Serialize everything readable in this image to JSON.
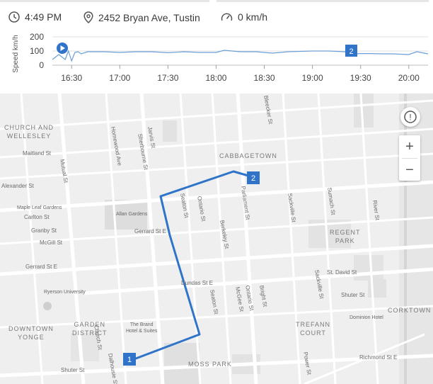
{
  "status": {
    "time": "4:49 PM",
    "address": "2452 Bryan Ave, Tustin",
    "speed": "0 km/h",
    "icons": [
      "clock-icon",
      "location-pin-icon",
      "speedometer-icon"
    ]
  },
  "chart_data": {
    "type": "line",
    "ylabel": "Speed km/h",
    "yticks": [
      "200",
      "100",
      "0"
    ],
    "ylim": [
      0,
      200
    ],
    "xticks": [
      "16:30",
      "17:00",
      "17:30",
      "18:00",
      "18:30",
      "19:00",
      "19:30",
      "20:00"
    ],
    "xlim": [
      "16:18",
      "20:12"
    ],
    "color": "#6a9fd8",
    "series": [
      {
        "x": [
          "16:18",
          "16:22",
          "16:26",
          "16:28",
          "16:30",
          "16:32",
          "16:34",
          "16:36",
          "16:40",
          "16:45",
          "16:50",
          "17:00",
          "17:10",
          "17:20",
          "17:30",
          "17:40",
          "17:50",
          "18:00",
          "18:05",
          "18:15",
          "18:25",
          "18:35",
          "18:45",
          "19:00",
          "19:10",
          "19:20",
          "19:25",
          "19:30",
          "19:35",
          "19:45",
          "19:50",
          "20:00",
          "20:05",
          "20:12"
        ],
        "y": [
          40,
          75,
          40,
          100,
          30,
          90,
          95,
          80,
          95,
          95,
          95,
          90,
          95,
          95,
          88,
          95,
          90,
          90,
          105,
          95,
          95,
          85,
          95,
          100,
          100,
          95,
          80,
          82,
          82,
          80,
          80,
          75,
          95,
          80
        ]
      }
    ],
    "markers": {
      "play": "play-icon",
      "waypoint_label": "2"
    }
  },
  "map": {
    "areas": [
      "CHURCH AND\nWELLESLEY",
      "CABBAGETOWN",
      "REGENT\nPARK",
      "CORKTOWN",
      "DOWNTOWN\nYONGE",
      "GARDEN\nDISTRICT",
      "TREFANN\nCOURT",
      "MOSS PARK"
    ],
    "streets": {
      "maitland": "Maitland St",
      "alexander": "Alexander St",
      "carlton": "Carlton St",
      "granby": "Granby St",
      "mcgill": "McGill St",
      "gerrard_w": "Gerrard St E",
      "gerrard_e": "Gerrard St E",
      "dundas": "Dundas St E",
      "shuter_e": "Shuter St",
      "shuter_w": "Shuter St",
      "richmond": "Richmond St E",
      "st_david": "St. David St",
      "mutual": "Mutual St",
      "homewood": "Homewood Ave",
      "jarvis": "Jarvis St",
      "sherbourne": "Sherbourne St",
      "parliament": "Parliament St",
      "sackville": "Sackville St",
      "sumach": "Sumach St",
      "river": "River St",
      "berkeley": "Berkeley St",
      "ontario": "Ontario St",
      "seaton": "Seaton St",
      "bright": "Bright St",
      "mcgee": "McGee St",
      "power": "Power St",
      "dalhousie": "Dalhousie St",
      "church": "Church St",
      "bleecker": "Bleecker St",
      "ontario2": "Ontario St",
      "sackville2": "Sackville St",
      "seaton2": "Seaton St"
    },
    "pois": {
      "maple_leaf": "Maple Leaf Gardens",
      "allan": "Allan Gardens",
      "ryerson": "Ryerson University",
      "brand": "The Brand\nHotel & Suites",
      "dominion": "Dominion Hotel"
    },
    "route_color": "#2f74c9",
    "start_label": "1",
    "end_label": "2",
    "controls": {
      "info": "!",
      "zoom_in": "+",
      "zoom_out": "−"
    }
  }
}
